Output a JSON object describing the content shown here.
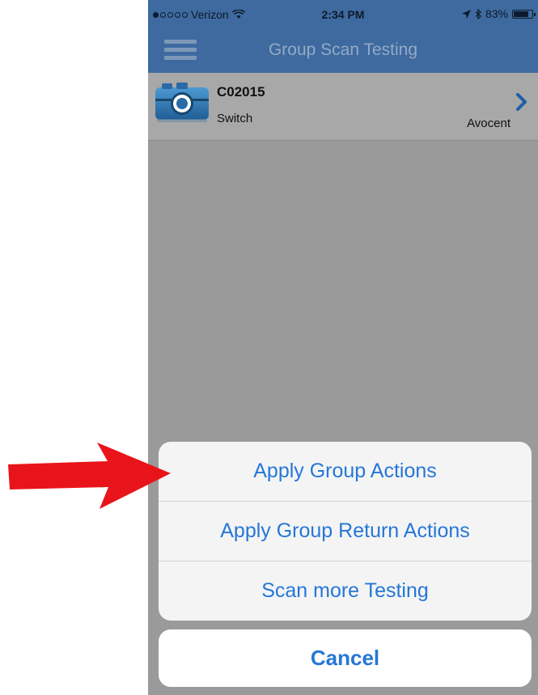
{
  "status_bar": {
    "carrier": "Verizon",
    "time": "2:34 PM",
    "battery": "83%",
    "battery_level": 0.83,
    "signal_bars_filled": 1,
    "icons": [
      "signal-dots-icon",
      "wifi-icon",
      "location-arrow-icon",
      "bluetooth-icon",
      "battery-icon"
    ]
  },
  "nav": {
    "title": "Group Scan Testing",
    "menu_icon": "hamburger-menu-icon"
  },
  "list": {
    "items": [
      {
        "id": "C02015",
        "type": "Switch",
        "vendor": "Avocent",
        "icon": "camera-icon"
      }
    ]
  },
  "action_sheet": {
    "actions": [
      {
        "label": "Apply Group Actions"
      },
      {
        "label": "Apply Group Return Actions"
      },
      {
        "label": "Scan more Testing"
      }
    ],
    "cancel_label": "Cancel"
  },
  "annotation": {
    "icon": "red-arrow-icon",
    "color": "#e8141a"
  },
  "colors": {
    "nav_background": "#3e6a9f",
    "action_text": "#2577d6",
    "overlay": "#9a9a9a"
  }
}
